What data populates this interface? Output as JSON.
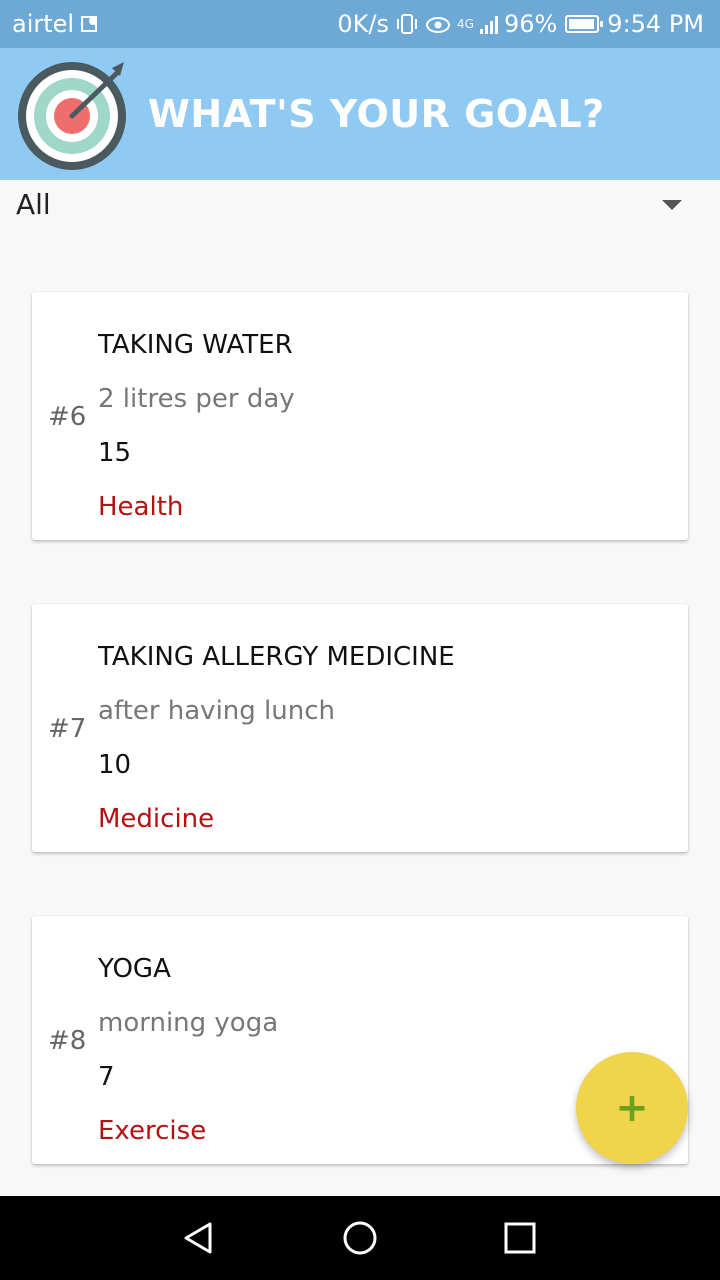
{
  "status_bar": {
    "carrier": "airtel",
    "net_speed": "0K/s",
    "network_type": "4G",
    "battery": "96%",
    "time": "9:54 PM"
  },
  "app_bar": {
    "title": "WHAT'S YOUR GOAL?",
    "logo_icon": "target-icon",
    "colors": {
      "bar": "#90c9f2",
      "status": "#6ea9d6"
    }
  },
  "filter": {
    "selected": "All"
  },
  "goals": [
    {
      "number": "#6",
      "title": "TAKING WATER",
      "description": "2 litres per day",
      "count": "15",
      "category": "Health"
    },
    {
      "number": "#7",
      "title": "TAKING ALLERGY MEDICINE",
      "description": "after having lunch",
      "count": "10",
      "category": "Medicine"
    },
    {
      "number": "#8",
      "title": "YOGA",
      "description": "morning yoga",
      "count": "7",
      "category": "Exercise"
    }
  ],
  "fab": {
    "label": "+",
    "color": "#f0d44c",
    "icon": "plus-icon"
  },
  "nav": {
    "back_icon": "back-triangle-icon",
    "home_icon": "home-circle-icon",
    "recents_icon": "recents-square-icon"
  }
}
